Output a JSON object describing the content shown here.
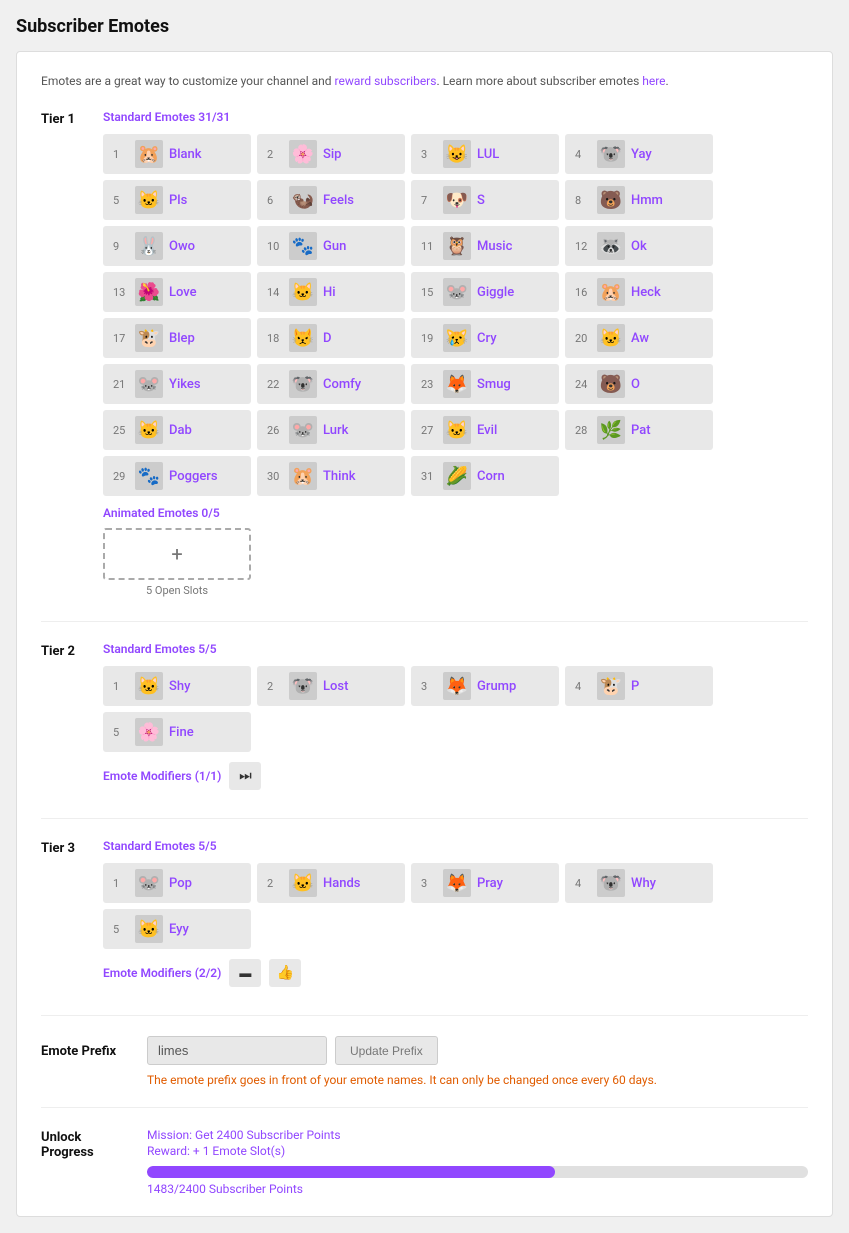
{
  "page": {
    "title": "Subscriber Emotes"
  },
  "info": {
    "text_before_link1": "Emotes are a great way to customize your channel and ",
    "link1_text": "reward subscribers",
    "text_between": ". Learn more about subscriber emotes ",
    "link2_text": "here",
    "text_after": "."
  },
  "tier1": {
    "label": "Tier 1",
    "standard_heading": "Standard Emotes 31/31",
    "animated_heading": "Animated Emotes 0/5",
    "open_slots": "5 Open Slots",
    "add_slot_plus": "+",
    "emotes": [
      {
        "num": 1,
        "name": "Blank",
        "emoji": "🐹"
      },
      {
        "num": 2,
        "name": "Sip",
        "emoji": "🌸"
      },
      {
        "num": 3,
        "name": "LUL",
        "emoji": "😺"
      },
      {
        "num": 4,
        "name": "Yay",
        "emoji": "🐨"
      },
      {
        "num": 5,
        "name": "Pls",
        "emoji": "🐱"
      },
      {
        "num": 6,
        "name": "Feels",
        "emoji": "🦦"
      },
      {
        "num": 7,
        "name": "S",
        "emoji": "🐶"
      },
      {
        "num": 8,
        "name": "Hmm",
        "emoji": "🐻"
      },
      {
        "num": 9,
        "name": "Owo",
        "emoji": "🐰"
      },
      {
        "num": 10,
        "name": "Gun",
        "emoji": "🐾"
      },
      {
        "num": 11,
        "name": "Music",
        "emoji": "🦉"
      },
      {
        "num": 12,
        "name": "Ok",
        "emoji": "🦝"
      },
      {
        "num": 13,
        "name": "Love",
        "emoji": "🌺"
      },
      {
        "num": 14,
        "name": "Hi",
        "emoji": "🐱"
      },
      {
        "num": 15,
        "name": "Giggle",
        "emoji": "🐭"
      },
      {
        "num": 16,
        "name": "Heck",
        "emoji": "🐹"
      },
      {
        "num": 17,
        "name": "Blep",
        "emoji": "🐮"
      },
      {
        "num": 18,
        "name": "D",
        "emoji": "😾"
      },
      {
        "num": 19,
        "name": "Cry",
        "emoji": "😿"
      },
      {
        "num": 20,
        "name": "Aw",
        "emoji": "🐱"
      },
      {
        "num": 21,
        "name": "Yikes",
        "emoji": "🐭"
      },
      {
        "num": 22,
        "name": "Comfy",
        "emoji": "🐨"
      },
      {
        "num": 23,
        "name": "Smug",
        "emoji": "🦊"
      },
      {
        "num": 24,
        "name": "O",
        "emoji": "🐻"
      },
      {
        "num": 25,
        "name": "Dab",
        "emoji": "🐱"
      },
      {
        "num": 26,
        "name": "Lurk",
        "emoji": "🐭"
      },
      {
        "num": 27,
        "name": "Evil",
        "emoji": "🐱"
      },
      {
        "num": 28,
        "name": "Pat",
        "emoji": "🌿"
      },
      {
        "num": 29,
        "name": "Poggers",
        "emoji": "🐾"
      },
      {
        "num": 30,
        "name": "Think",
        "emoji": "🐹"
      },
      {
        "num": 31,
        "name": "Corn",
        "emoji": "🌽"
      }
    ]
  },
  "tier2": {
    "label": "Tier 2",
    "standard_heading": "Standard Emotes 5/5",
    "emote_modifiers_label": "Emote Modifiers (1/1)",
    "emotes": [
      {
        "num": 1,
        "name": "Shy",
        "emoji": "🐱"
      },
      {
        "num": 2,
        "name": "Lost",
        "emoji": "🐨"
      },
      {
        "num": 3,
        "name": "Grump",
        "emoji": "🦊"
      },
      {
        "num": 4,
        "name": "P",
        "emoji": "🐮"
      },
      {
        "num": 5,
        "name": "Fine",
        "emoji": "🌸"
      }
    ],
    "modifier_icon": "⏭"
  },
  "tier3": {
    "label": "Tier 3",
    "standard_heading": "Standard Emotes 5/5",
    "emote_modifiers_label": "Emote Modifiers (2/2)",
    "emotes": [
      {
        "num": 1,
        "name": "Pop",
        "emoji": "🐭"
      },
      {
        "num": 2,
        "name": "Hands",
        "emoji": "🐱"
      },
      {
        "num": 3,
        "name": "Pray",
        "emoji": "🦊"
      },
      {
        "num": 4,
        "name": "Why",
        "emoji": "🐨"
      },
      {
        "num": 5,
        "name": "Eyy",
        "emoji": "🐱"
      }
    ],
    "modifier_icons": [
      "▬",
      "👍"
    ]
  },
  "emote_prefix": {
    "label": "Emote Prefix",
    "input_value": "limes",
    "button_label": "Update Prefix",
    "note": "The emote prefix goes in front of your emote names. It can only be changed once every 60 days."
  },
  "unlock_progress": {
    "label": "Unlock\nProgress",
    "mission": "Mission: Get 2400 Subscriber Points",
    "reward": "Reward: + 1 Emote Slot(s)",
    "current": 1483,
    "total": 2400,
    "progress_text": "1483/2400 Subscriber Points"
  }
}
